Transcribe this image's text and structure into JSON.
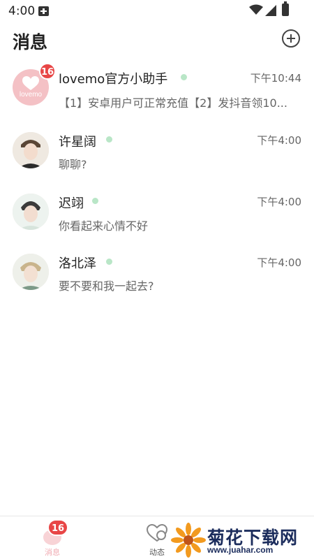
{
  "status_bar": {
    "time": "4:00",
    "icons": [
      "notification-plus-icon",
      "wifi-icon",
      "signal-icon",
      "battery-icon"
    ]
  },
  "header": {
    "title": "消息",
    "add_icon": "plus-circle-icon"
  },
  "conversations": [
    {
      "name": "lovemo官方小助手",
      "time": "下午10:44",
      "preview": "【1】安卓用户可正常充值【2】发抖音领10...",
      "badge": "16",
      "avatar_text": "lovemo",
      "online": true
    },
    {
      "name": "许星阔",
      "time": "下午4:00",
      "preview": "聊聊?",
      "online": true
    },
    {
      "name": "迟翊",
      "time": "下午4:00",
      "preview": "你看起来心情不好",
      "online": true
    },
    {
      "name": "洛北泽",
      "time": "下午4:00",
      "preview": "要不要和我一起去?",
      "online": true
    }
  ],
  "bottom_nav": {
    "items": [
      {
        "label": "消息",
        "badge": "16",
        "active": true,
        "icon": "message-bubble-icon"
      },
      {
        "label": "动态",
        "active": false,
        "icon": "moments-icon"
      }
    ]
  },
  "watermark": {
    "title": "菊花下载网",
    "url": "www.juahar.com"
  },
  "colors": {
    "badge": "#e84646",
    "online_dot": "#b9e6c7",
    "active_tab": "#f0a9b0",
    "avatar_brand": "#f4c1c5"
  }
}
